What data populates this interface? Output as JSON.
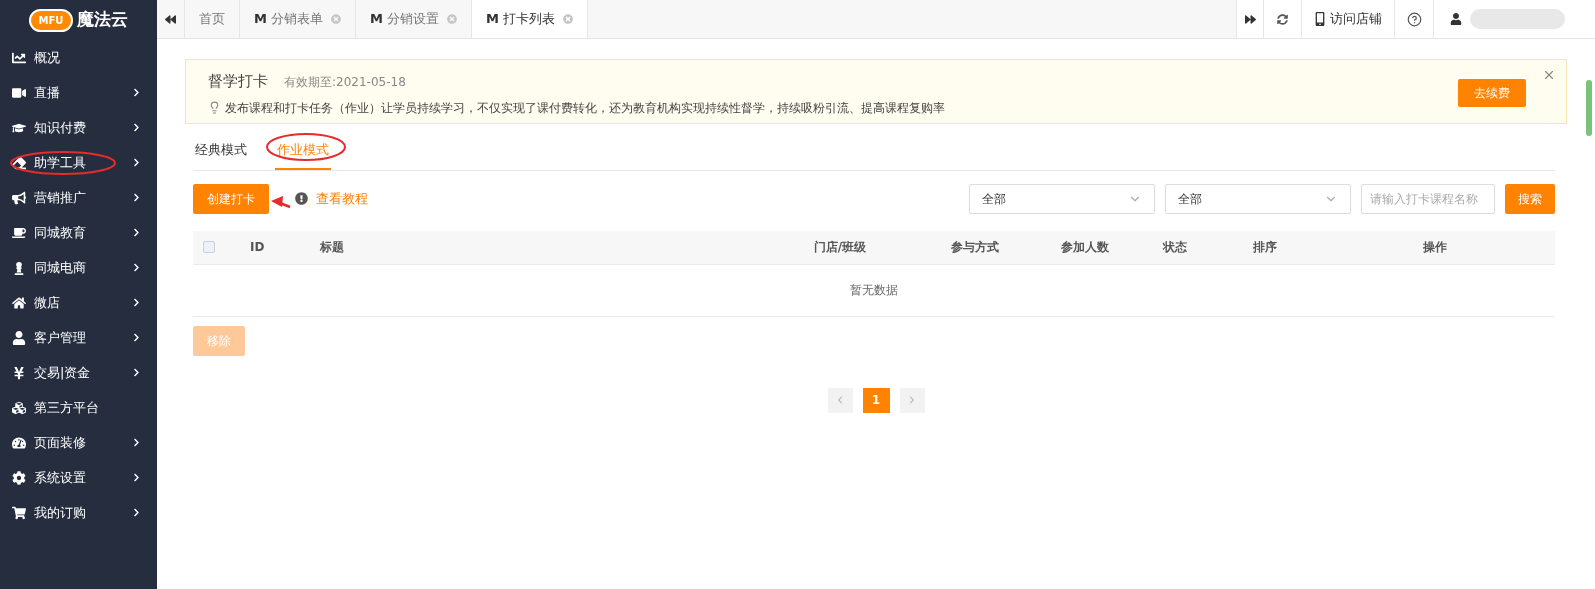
{
  "sidebar": {
    "logo_badge": "MFU",
    "logo_text": "魔法云",
    "items": [
      {
        "label": "概况",
        "has_submenu": false
      },
      {
        "label": "直播",
        "has_submenu": true
      },
      {
        "label": "知识付费",
        "has_submenu": true
      },
      {
        "label": "助学工具",
        "has_submenu": true
      },
      {
        "label": "营销推广",
        "has_submenu": true
      },
      {
        "label": "同城教育",
        "has_submenu": true
      },
      {
        "label": "同城电商",
        "has_submenu": true
      },
      {
        "label": "微店",
        "has_submenu": true
      },
      {
        "label": "客户管理",
        "has_submenu": true
      },
      {
        "label": "交易|资金",
        "has_submenu": true
      },
      {
        "label": "第三方平台",
        "has_submenu": false
      },
      {
        "label": "页面装修",
        "has_submenu": true
      },
      {
        "label": "系统设置",
        "has_submenu": true
      },
      {
        "label": "我的订购",
        "has_submenu": true
      }
    ]
  },
  "tabs": [
    {
      "label": "首页",
      "selected": false,
      "closable": false
    },
    {
      "label": "分销表单",
      "badge": "M",
      "selected": false,
      "closable": true
    },
    {
      "label": "分销设置",
      "badge": "M",
      "selected": false,
      "closable": true
    },
    {
      "label": "打卡列表",
      "badge": "M",
      "selected": true,
      "closable": true
    }
  ],
  "toolbar": {
    "visit_store": "访问店铺"
  },
  "banner": {
    "title": "督学打卡",
    "validity": "有效期至:2021-05-18",
    "description": "发布课程和打卡任务（作业）让学员持续学习，不仅实现了课付费转化，还为教育机构实现持续性督学，持续吸粉引流、提高课程复购率",
    "renew_button": "去续费"
  },
  "mode_tabs": [
    {
      "label": "经典模式",
      "selected": false
    },
    {
      "label": "作业模式",
      "selected": true
    }
  ],
  "actions": {
    "create_button": "创建打卡",
    "tutorial_link": "查看教程"
  },
  "filters": {
    "selects": [
      "全部",
      "全部"
    ],
    "search_placeholder": "请输入打卡课程名称",
    "search_button": "搜索"
  },
  "table": {
    "select_all_checked": false,
    "columns": [
      "ID",
      "标题",
      "门店/班级",
      "参与方式",
      "参加人数",
      "状态",
      "排序",
      "操作"
    ],
    "empty_text": "暂无数据"
  },
  "remove_button": {
    "label": "移除",
    "disabled": true
  },
  "pagination": {
    "pages": [
      {
        "label": "1",
        "selected": true
      }
    ]
  }
}
